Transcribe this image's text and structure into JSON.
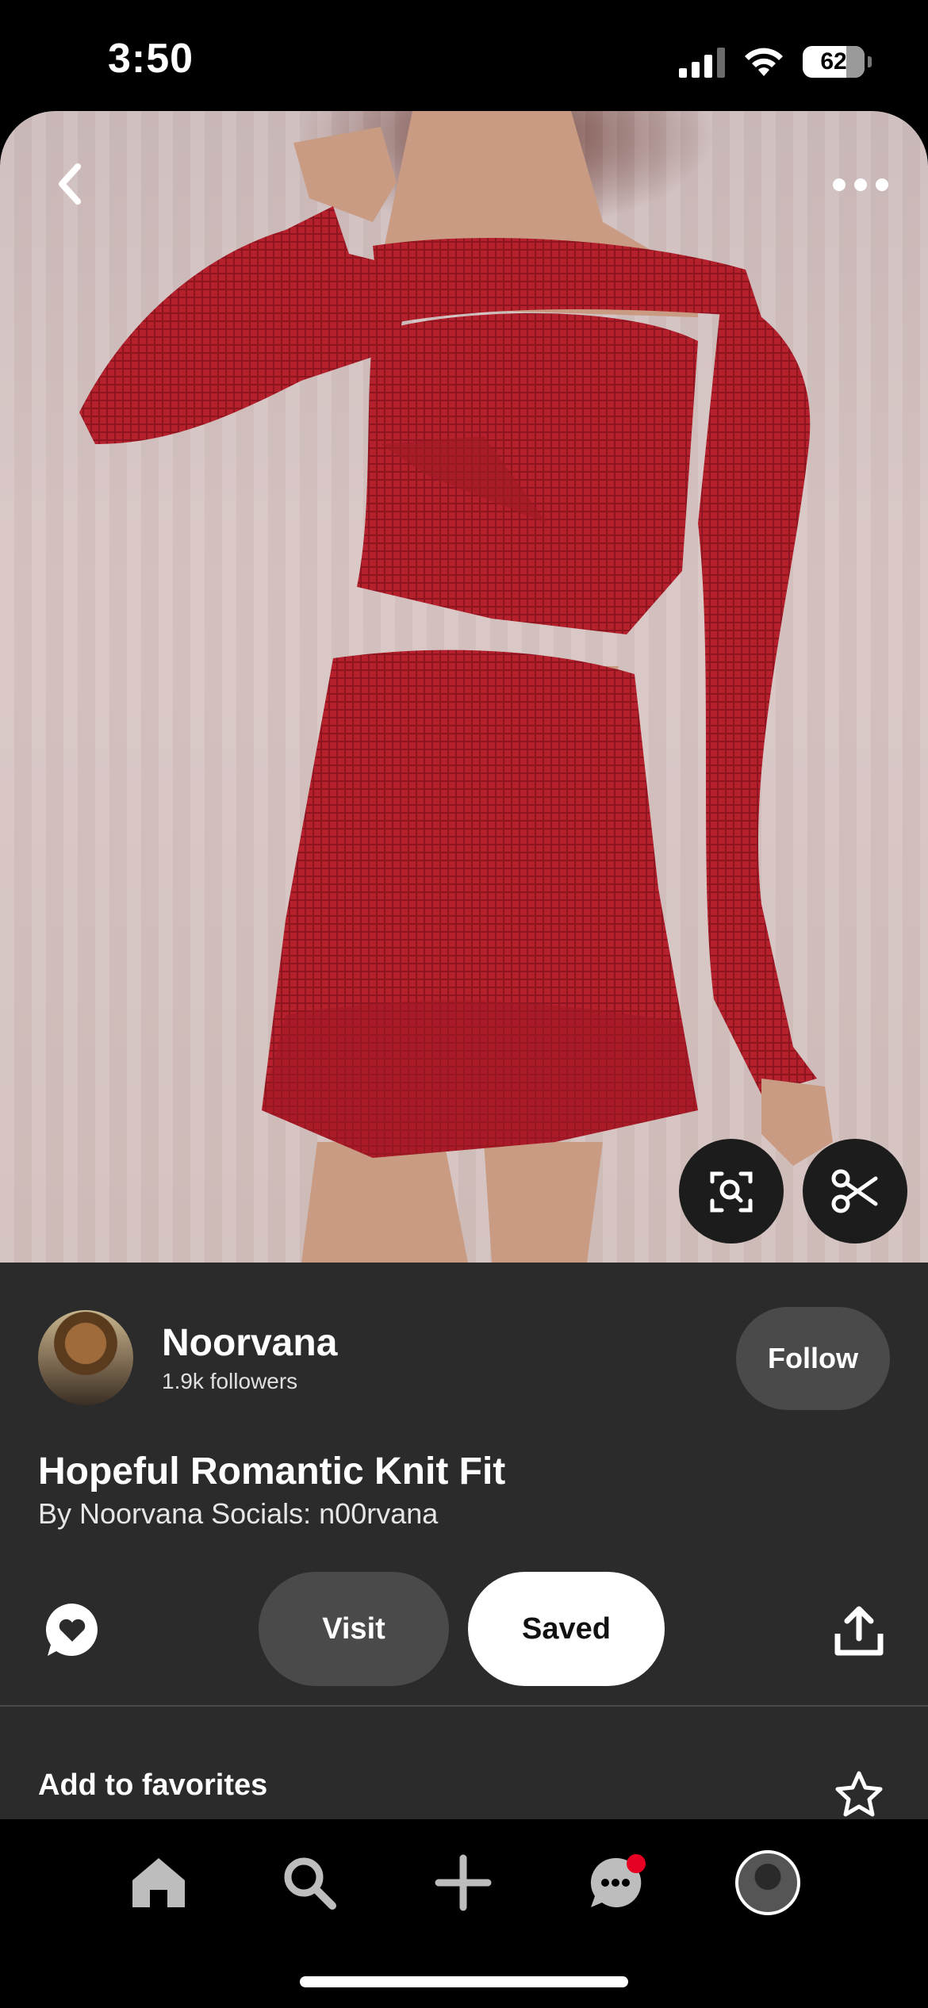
{
  "status_bar": {
    "time": "3:50",
    "battery": "62"
  },
  "pin": {
    "image_alt": "Red knit crop top and skirt outfit",
    "actions": {
      "visual_search": "visual-search-icon",
      "cutout": "scissors-icon"
    }
  },
  "creator": {
    "name": "Noorvana",
    "followers": "1.9k followers",
    "follow_label": "Follow"
  },
  "details": {
    "title": "Hopeful Romantic Knit Fit",
    "byline": "By Noorvana Socials: n00rvana"
  },
  "action_bar": {
    "visit_label": "Visit",
    "saved_label": "Saved"
  },
  "favorites": {
    "label": "Add to favorites"
  },
  "nav": {
    "items": [
      "home-icon",
      "search-icon",
      "create-icon",
      "messages-icon",
      "profile-avatar"
    ],
    "notification_color": "#e60023"
  },
  "colors": {
    "panel": "#2b2b2b",
    "button": "#4a4a4a",
    "saved_bg": "#ffffff",
    "accent": "#e60023"
  }
}
